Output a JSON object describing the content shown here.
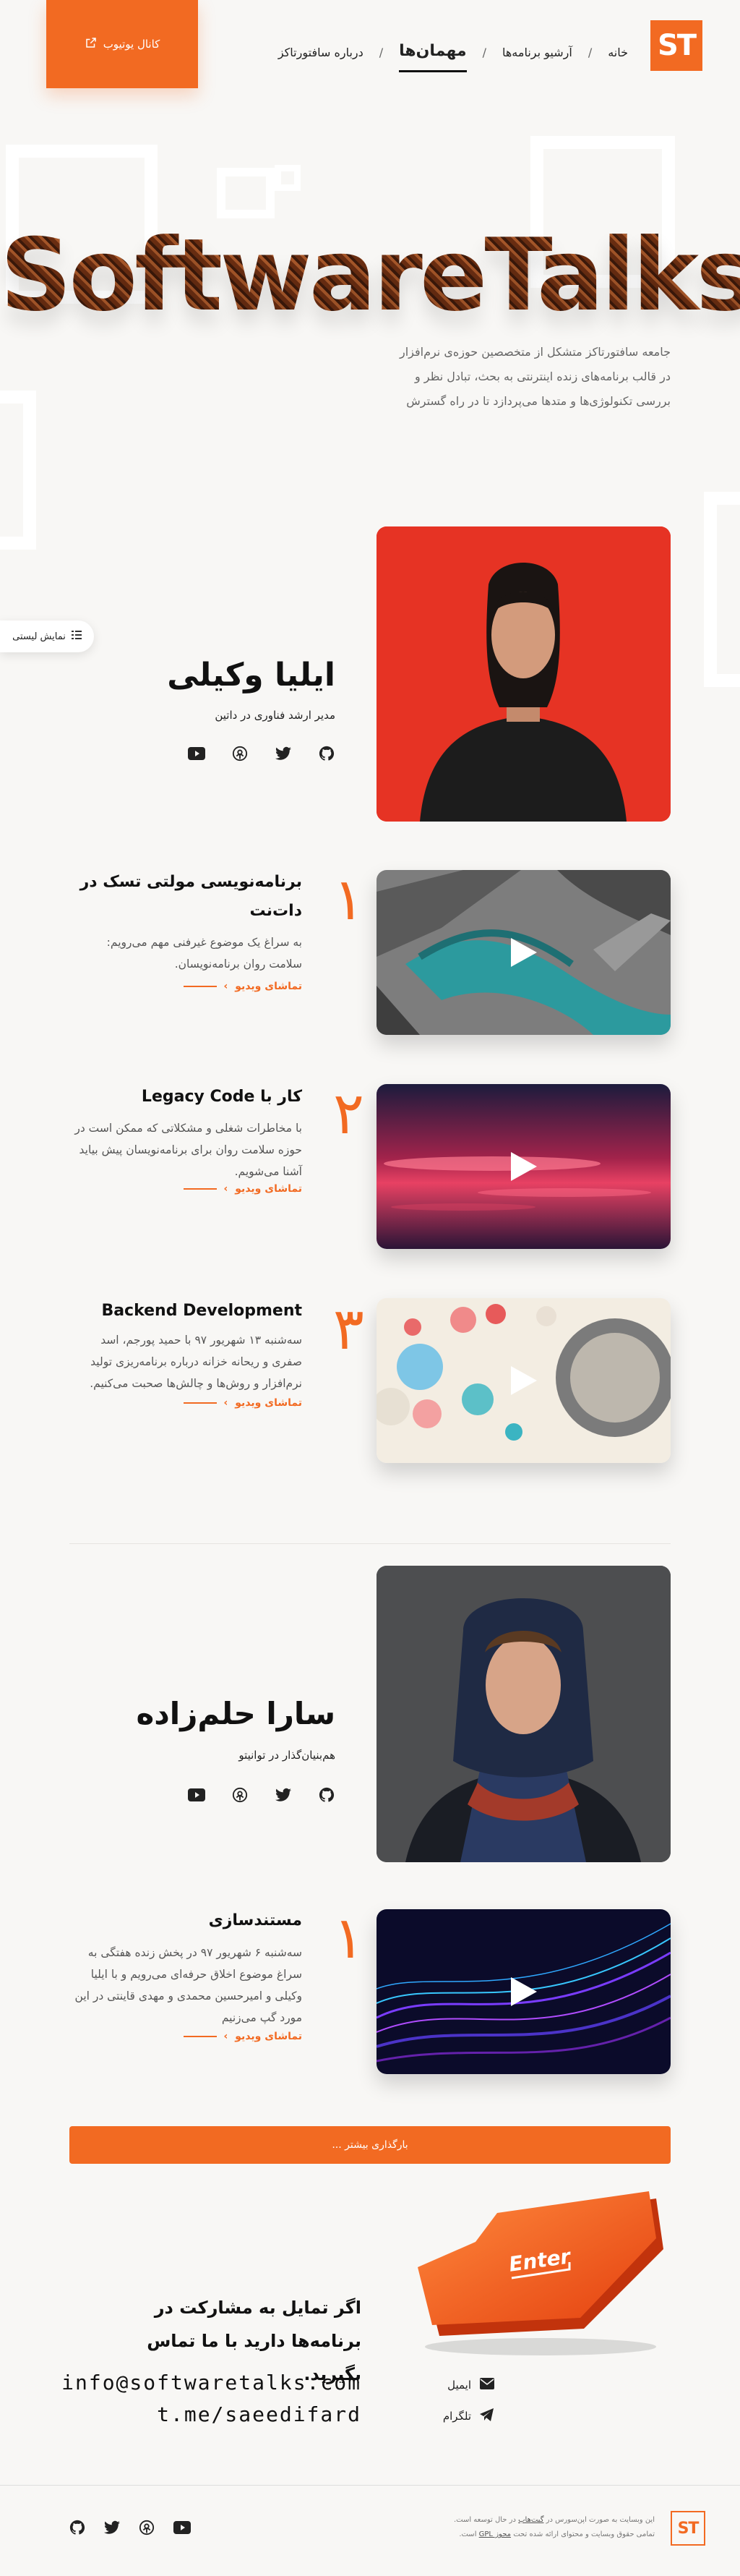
{
  "header": {
    "logo": "ST",
    "nav": [
      {
        "label": "خانه"
      },
      {
        "label": "آرشیو برنامه‌ها"
      },
      {
        "label": "مهمان‌ها"
      },
      {
        "label": "درباره سافتورتاکز"
      }
    ],
    "youtube_button": "کانال یوتیوب"
  },
  "hero": {
    "title": "SoftwareTalks",
    "description": "جامعه سافتورتاکز متشکل از متخصصین حوزه‌ی نرم‌افزار در قالب برنامه‌های زنده اینترنتی به بحث، تبادل نظر و بررسی تکنولوژی‌ها و متدها می‌پردازد تا در راه گسترش"
  },
  "list_toggle": "نمایش لیستی",
  "guests": [
    {
      "name": "ایلیا وکیلی",
      "role": "مدیر ارشد فناوری در داتین",
      "episodes": [
        {
          "number": "۱",
          "title": "برنامه‌نویسی مولتی تسک در دات‌نت",
          "description": "به سراغ یک موضوع غیرفنی مهم می‌رویم: سلامت روان برنامه‌نویسان.",
          "link": "تماشای ویدیو"
        },
        {
          "number": "۲",
          "title": "کار با Legacy Code",
          "description": "با مخاطرات شغلی و مشکلاتی که ممکن است در حوزه سلامت روان برای برنامه‌نویسان پیش بیاید آشنا می‌شویم.",
          "link": "تماشای ویدیو"
        },
        {
          "number": "۳",
          "title": "Backend Development",
          "description": "سه‌شنبه ۱۳ شهریور ۹۷ با حمید پورجم، اسد صفری و ریحانه خزانه درباره برنامه‌ریزی تولید نرم‌افزار و روش‌ها و چالش‌ها صحبت می‌کنیم.",
          "link": "تماشای ویدیو"
        }
      ]
    },
    {
      "name": "سارا حلم‌زاده",
      "role": "هم‌بنیان‌گذار در توانیتو",
      "episodes": [
        {
          "number": "۱",
          "title": "مستندسازی",
          "description": "سه‌شنبه ۶ شهریور ۹۷ در پخش زنده هفتگی به سراغ موضوع اخلاق حرفه‌ای می‌رویم و با ایلیا وکیلی و امیرحسین محمدی و مهدی قاینتی در این مورد گپ می‌زنیم",
          "link": "تماشای ویدیو"
        }
      ]
    }
  ],
  "more_button": "بارگذاری بیشتر ...",
  "contact": {
    "title": "اگر تمایل به مشارکت در برنامه‌ها دارید با ما تماس بگیرید.",
    "email": "info@softwaretalks.com",
    "telegram": "t.me/saeedifard",
    "email_label": "ایمیل",
    "telegram_label": "تلگرام",
    "key_label": "Enter"
  },
  "footer": {
    "logo": "ST",
    "text_1": "این وبسایت به صورت اپن‌سورس در",
    "text_link": "گیت‌هاب",
    "text_2": "در حال توسعه است.",
    "text_3": "تمامی حقوق وبسایت و محتوای ارائه شده تحت",
    "license": "مجوز GPL",
    "text_4": "است."
  },
  "colors": {
    "accent": "#f26a22",
    "background": "#f8f7f5"
  }
}
